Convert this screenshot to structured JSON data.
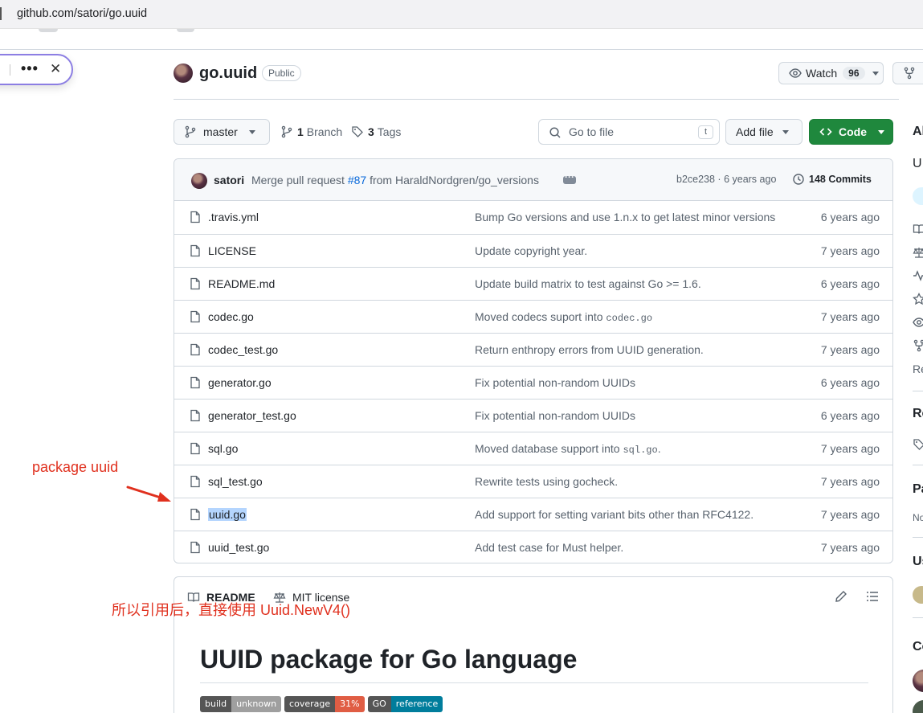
{
  "browser": {
    "url": "github.com/satori/go.uuid"
  },
  "repo": {
    "name": "go.uuid",
    "visibility": "Public",
    "watch_label": "Watch",
    "watch_count": "96"
  },
  "toolbar": {
    "branch": "master",
    "branches_count": "1",
    "branches_label": "Branch",
    "tags_count": "3",
    "tags_label": "Tags",
    "search_placeholder": "Go to file",
    "search_kbd": "t",
    "add_file": "Add file",
    "code": "Code"
  },
  "latest_commit": {
    "author": "satori",
    "message_prefix": "Merge pull request",
    "pr": "#87",
    "message_suffix": "from HaraldNordgren/go_versions",
    "sha_age": "b2ce238 · 6 years ago",
    "commits": "148 Commits"
  },
  "files": [
    {
      "name": ".travis.yml",
      "message": "Bump Go versions and use 1.n.x to get latest minor versions",
      "age": "6 years ago"
    },
    {
      "name": "LICENSE",
      "message": "Update copyright year.",
      "age": "7 years ago"
    },
    {
      "name": "README.md",
      "message": "Update build matrix to test against Go >= 1.6.",
      "age": "6 years ago"
    },
    {
      "name": "codec.go",
      "message": "Moved codecs suport into ",
      "message_code": "codec.go",
      "age": "7 years ago"
    },
    {
      "name": "codec_test.go",
      "message": "Return enthropy errors from UUID generation.",
      "age": "7 years ago"
    },
    {
      "name": "generator.go",
      "message": "Fix potential non-random UUIDs",
      "age": "6 years ago"
    },
    {
      "name": "generator_test.go",
      "message": "Fix potential non-random UUIDs",
      "age": "6 years ago"
    },
    {
      "name": "sql.go",
      "message": "Moved database support into ",
      "message_code": "sql.go",
      "message_tail": ".",
      "age": "7 years ago"
    },
    {
      "name": "sql_test.go",
      "message": "Rewrite tests using gocheck.",
      "age": "7 years ago"
    },
    {
      "name": "uuid.go",
      "message": "Add support for setting variant bits other than RFC4122.",
      "age": "7 years ago",
      "selected": true
    },
    {
      "name": "uuid_test.go",
      "message": "Add test case for Must helper.",
      "age": "7 years ago"
    }
  ],
  "readme": {
    "tab_readme": "README",
    "tab_license": "MIT license",
    "title": "UUID package for Go language",
    "badges": [
      {
        "label": "build",
        "value": "unknown",
        "color": "#9f9f9f"
      },
      {
        "label": "coverage",
        "value": "31%",
        "color": "#e05d44"
      },
      {
        "label": "GO",
        "value": "reference",
        "color": "#007d9c"
      }
    ]
  },
  "sidebar_fragments": {
    "about": "Al",
    "desc": "U",
    "releases": "Re",
    "re_text": "Re",
    "packages": "Pa",
    "no": "No",
    "used": "Us",
    "contrib": "Co"
  },
  "annotations": {
    "package_note": "package uuid",
    "usage_note": "所以引用后，直接使用 Uuid.NewV4()"
  },
  "colors": {
    "accent": "#0969da",
    "code_button": "#1f883d",
    "annotation": "#e0301e",
    "selection": "#b4d5fe"
  }
}
